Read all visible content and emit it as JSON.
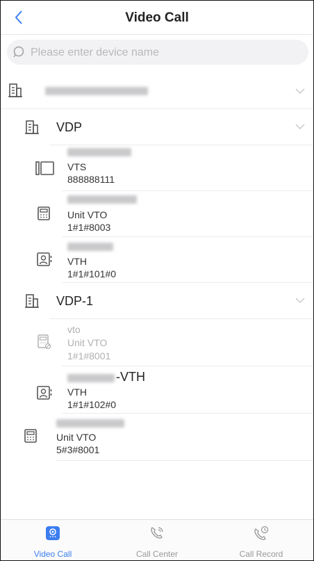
{
  "header": {
    "title": "Video Call"
  },
  "search": {
    "placeholder": "Please enter device name"
  },
  "site": {
    "name": ""
  },
  "groups": [
    {
      "label": "VDP"
    },
    {
      "label": "VDP-1"
    }
  ],
  "devices": [
    {
      "type": "VTS",
      "number": "888888111"
    },
    {
      "type": "Unit VTO",
      "number": "1#1#8003"
    },
    {
      "type": "VTH",
      "number": "1#1#101#0"
    },
    {
      "name": "vto",
      "type": "Unit VTO",
      "number": "1#1#8001"
    },
    {
      "name_suffix": "-VTH",
      "type": "VTH",
      "number": "1#1#102#0"
    },
    {
      "type": "Unit VTO",
      "number": "5#3#8001"
    }
  ],
  "tabs": [
    {
      "label": "Video Call"
    },
    {
      "label": "Call Center"
    },
    {
      "label": "Call Record"
    }
  ],
  "colors": {
    "accent": "#3b7df0",
    "icon": "#555555",
    "offline": "#b0b0b0"
  }
}
